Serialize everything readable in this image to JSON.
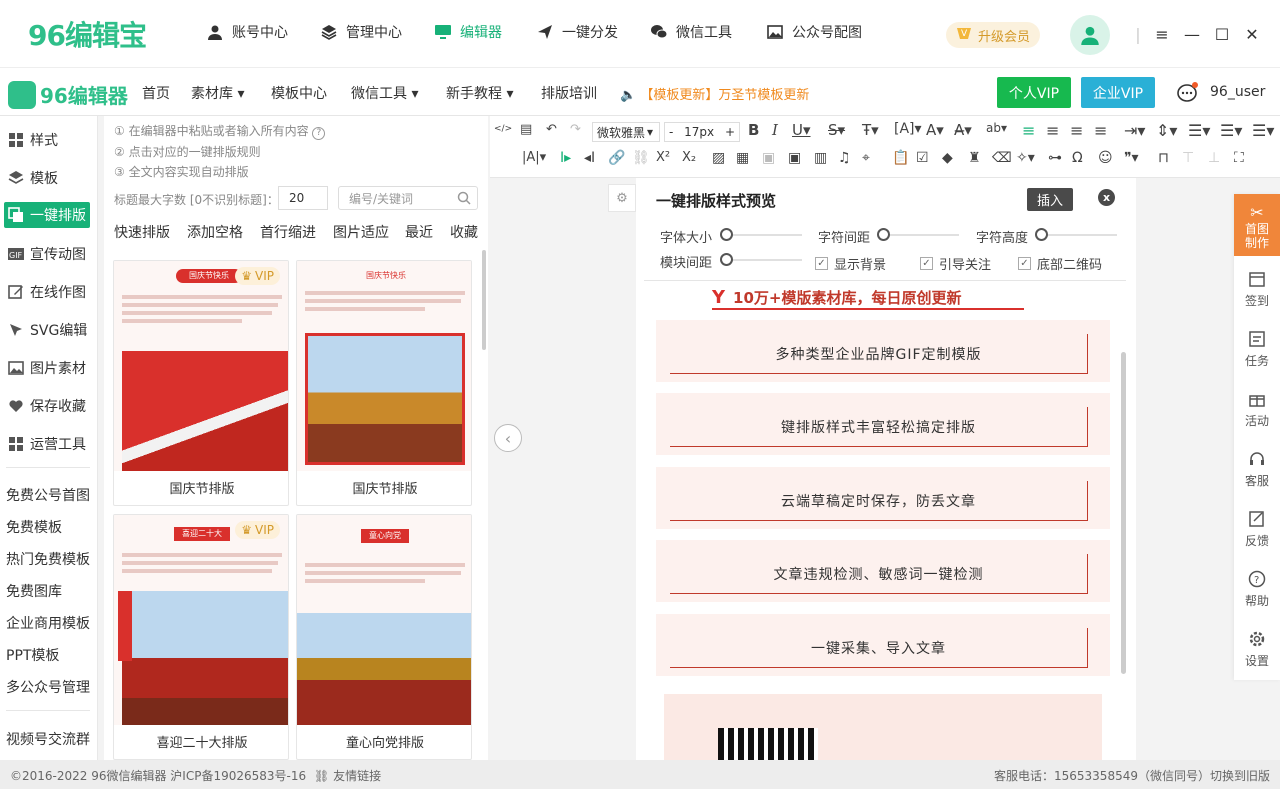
{
  "app": {
    "logo_num": "96",
    "logo_text": "编辑宝",
    "vip_upgrade": "升级会员"
  },
  "topnav": [
    {
      "label": "账号中心",
      "icon": "user-icon"
    },
    {
      "label": "管理中心",
      "icon": "layers-icon"
    },
    {
      "label": "编辑器",
      "icon": "monitor-icon"
    },
    {
      "label": "一键分发",
      "icon": "send-icon"
    },
    {
      "label": "微信工具",
      "icon": "wechat-icon"
    },
    {
      "label": "公众号配图",
      "icon": "image-icon"
    }
  ],
  "bar2": {
    "logo_text": "96编辑器",
    "nav": [
      "首页",
      "素材库 ▾",
      "模板中心",
      "微信工具 ▾",
      "新手教程 ▾",
      "排版培训"
    ],
    "notice": "【模板更新】万圣节模板更新",
    "btn_vip": "个人VIP",
    "btn_enterprise": "企业VIP",
    "username": "96_user"
  },
  "sidebar": {
    "items": [
      "样式",
      "模板",
      "一键排版",
      "宣传动图",
      "在线作图",
      "SVG编辑",
      "图片素材",
      "保存收藏",
      "运营工具"
    ],
    "links": [
      "免费公号首图",
      "免费模板",
      "热门免费模板",
      "免费图库",
      "企业商用模板",
      "PPT模板",
      "多公众号管理"
    ],
    "bottom": "视频号交流群"
  },
  "panel": {
    "tips": [
      "① 在编辑器中粘贴或者输入所有内容",
      "② 点击对应的一键排版规则",
      "③ 全文内容实现自动排版"
    ],
    "max_label": "标题最大字数 [0不识别标题]：",
    "max_value": "20",
    "keyword_placeholder": "编号/关键词",
    "tabs": [
      "快速排版",
      "添加空格",
      "首行缩进",
      "图片适应",
      "最近",
      "收藏"
    ],
    "cards": [
      {
        "label": "国庆节排版",
        "vip": true,
        "tag": "国庆节快乐"
      },
      {
        "label": "国庆节排版",
        "vip": false,
        "tag": "国庆节快乐"
      },
      {
        "label": "喜迎二十大排版",
        "vip": true,
        "tag": "喜迎二十大"
      },
      {
        "label": "童心向党排版",
        "vip": false,
        "tag": "童心向党"
      }
    ],
    "vip_label": "VIP"
  },
  "toolbar": {
    "font": "微软雅黑",
    "size": "17px"
  },
  "preview": {
    "title": "一键排版样式预览",
    "insert": "插入",
    "close": "x",
    "sliders": [
      "字体大小",
      "字符间距",
      "字符高度",
      "模块间距"
    ],
    "checks": [
      "显示背景",
      "引导关注",
      "底部二维码"
    ],
    "headline": "10万+模版素材库，每日原创更新",
    "features": [
      "多种类型企业品牌GIF定制模版",
      "键排版样式丰富轻松搞定排版",
      "云端草稿定时保存，防丢文章",
      "文章违规检测、敏感词一键检测",
      "一键采集、导入文章"
    ]
  },
  "rpanel": {
    "items": [
      "首图制作",
      "签到",
      "任务",
      "活动",
      "客服",
      "反馈",
      "帮助",
      "设置"
    ]
  },
  "footer": {
    "copyright": "©2016-2022 96微信编辑器 沪ICP备19026583号-16",
    "link": "友情链接",
    "phone": "客服电话：15653358549（微信同号）",
    "old": "切换到旧版"
  },
  "colors": {
    "accent": "#17b178",
    "orange": "#f0863a",
    "red": "#c0392b"
  }
}
